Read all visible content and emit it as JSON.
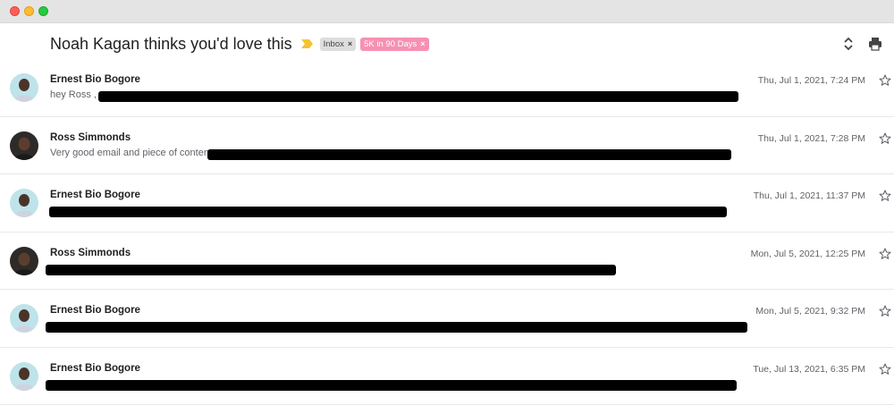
{
  "window": {
    "controls": [
      "close",
      "minimize",
      "zoom"
    ]
  },
  "thread": {
    "subject": "Noah Kagan thinks you'd love this",
    "importance_icon": "importance-marker-icon",
    "labels": [
      {
        "text": "Inbox",
        "remove": "×",
        "color": "#dddddd"
      },
      {
        "text": "5K in 90 Days",
        "remove": "×",
        "color": "#f691b2"
      }
    ],
    "actions": {
      "expand_icon": "expand-collapse-icon",
      "print_icon": "print-icon"
    }
  },
  "messages": [
    {
      "sender": "Ernest Bio Bogore",
      "snippet": "hey Ross , ",
      "date": "Thu, Jul 1, 2021, 7:24 PM",
      "avatar": "light"
    },
    {
      "sender": "Ross Simmonds",
      "snippet": "Very good email and piece of content",
      "date": "Thu, Jul 1, 2021, 7:28 PM",
      "avatar": "dark"
    },
    {
      "sender": "Ernest Bio Bogore",
      "snippet": "",
      "date": "Thu, Jul 1, 2021, 11:37 PM",
      "avatar": "light"
    },
    {
      "sender": "Ross Simmonds",
      "snippet": "",
      "date": "Mon, Jul 5, 2021, 12:25 PM",
      "avatar": "dark"
    },
    {
      "sender": "Ernest Bio Bogore",
      "snippet": "",
      "date": "Mon, Jul 5, 2021, 9:32 PM",
      "avatar": "light"
    },
    {
      "sender": "Ernest Bio Bogore",
      "snippet": "",
      "date": "Tue, Jul 13, 2021, 6:35 PM",
      "avatar": "light"
    }
  ],
  "colors": {
    "label_inbox_bg": "#dddddd",
    "label_custom_bg": "#f691b2",
    "importance": "#f4c430",
    "redaction": "#000000"
  }
}
